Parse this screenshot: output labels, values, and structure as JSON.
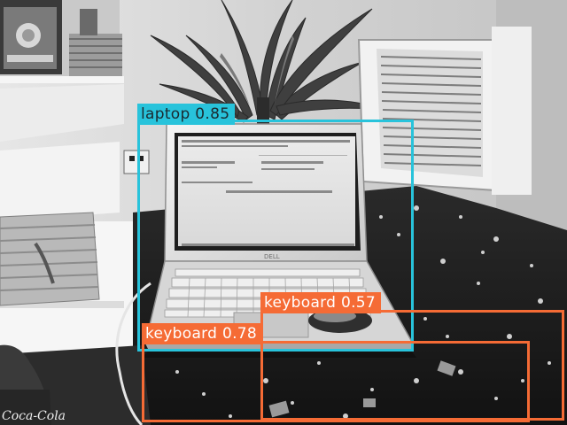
{
  "image": {
    "scene": "black-and-white photo of an open laptop on a dark patterned bedspread with a mouse, plants, a wicker basket, a stereo and a window air conditioner",
    "detections": [
      {
        "label": "laptop",
        "score": "0.85",
        "text": "laptop 0.85",
        "color": "#28c3db"
      },
      {
        "label": "keyboard",
        "score": "0.57",
        "text": "keyboard 0.57",
        "color": "#f56b35"
      },
      {
        "label": "keyboard",
        "score": "0.78",
        "text": "keyboard 0.78",
        "color": "#f56b35"
      }
    ],
    "bottle_text": "Coca-Cola",
    "laptop_brand": "DELL"
  }
}
